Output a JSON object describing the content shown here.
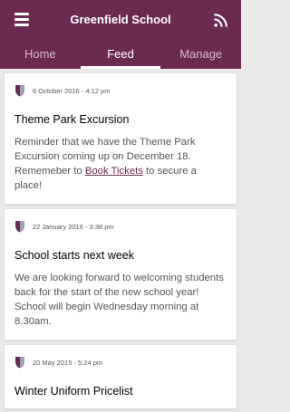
{
  "header": {
    "title": "Greenfield School"
  },
  "tabs": [
    {
      "label": "Home"
    },
    {
      "label": "Feed"
    },
    {
      "label": "Manage"
    }
  ],
  "posts": [
    {
      "date": "6 October 2016 - 4:12 pm",
      "title": "Theme Park Excursion",
      "body_before": "Reminder that we have the Theme Park Excursion coming up on December 18. Rememeber to ",
      "link": "Book Tickets",
      "body_after": " to secure a place!"
    },
    {
      "date": "22 January 2016 - 3:38 pm",
      "title": "School starts next week",
      "body": "We are looking forward to welcoming students back for the start of the new school year! School will begin Wednesday morning at 8.30am."
    },
    {
      "date": "20 May 2015 - 5:24 pm",
      "title": "Winter Uniform Pricelist"
    }
  ],
  "colors": {
    "brand": "#6b2a52",
    "tab_inactive": "#d7b9cc"
  },
  "icons": {
    "menu": "hamburger-icon",
    "feed": "rss-icon",
    "post": "shield-icon"
  }
}
